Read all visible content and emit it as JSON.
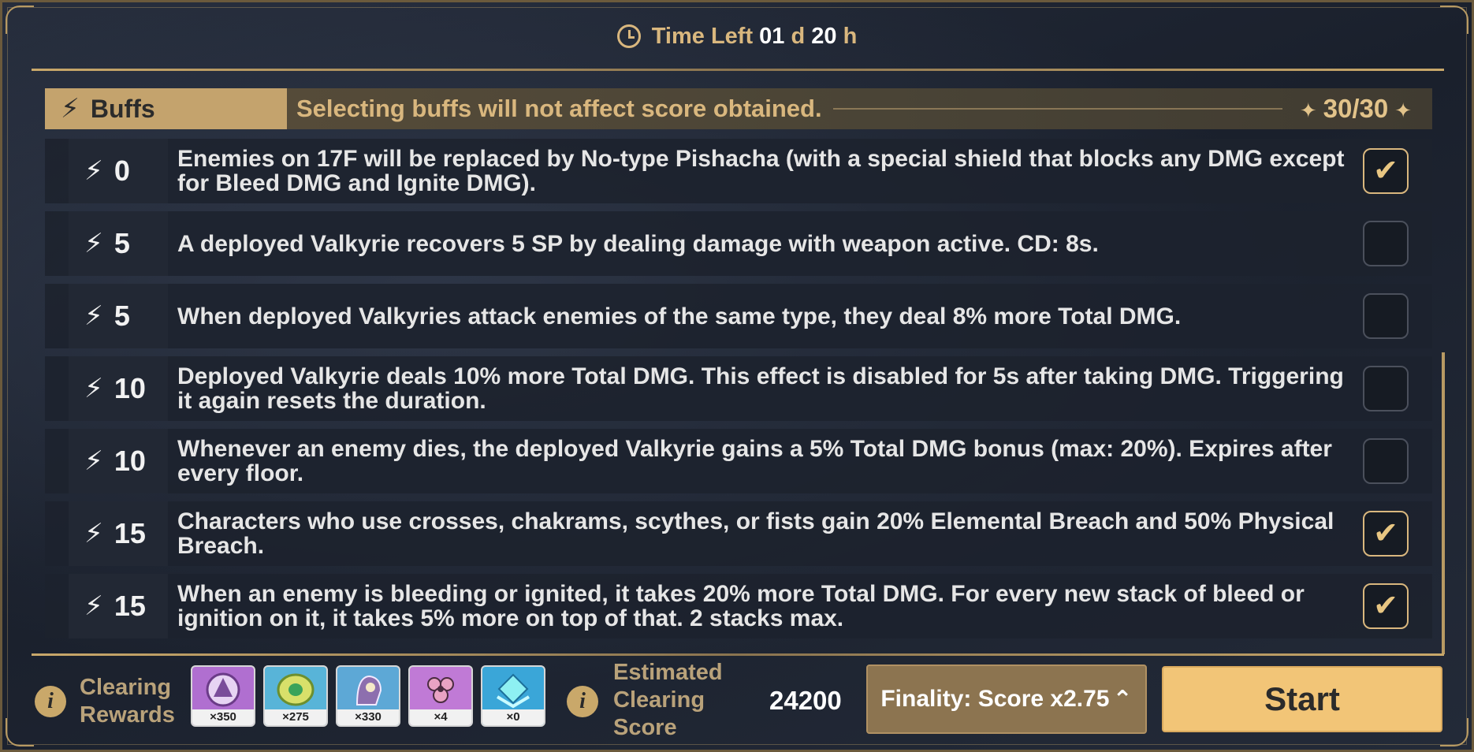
{
  "header": {
    "time_left_label": "Time Left",
    "days_value": "01",
    "days_unit": "d",
    "hours_value": "20",
    "hours_unit": "h"
  },
  "buffs": {
    "tab_label": "Buffs",
    "note": "Selecting buffs will not affect score obtained.",
    "count": "30/30",
    "items": [
      {
        "cost": "0",
        "description": "Enemies on 17F will be replaced by No-type Pishacha (with a special shield that blocks any DMG except for Bleed DMG and Ignite DMG).",
        "checked": true
      },
      {
        "cost": "5",
        "description": "A deployed Valkyrie recovers 5 SP by dealing damage with weapon active. CD: 8s.",
        "checked": false
      },
      {
        "cost": "5",
        "description": "When deployed Valkyries attack enemies of the same type, they deal 8% more Total DMG.",
        "checked": false
      },
      {
        "cost": "10",
        "description": "Deployed Valkyrie deals 10% more Total DMG. This effect is disabled for 5s after taking DMG. Triggering it again resets the duration.",
        "checked": false
      },
      {
        "cost": "10",
        "description": "Whenever an enemy dies, the deployed Valkyrie gains a 5% Total DMG bonus (max: 20%). Expires after every floor.",
        "checked": false
      },
      {
        "cost": "15",
        "description": "Characters who use crosses, chakrams, scythes, or fists gain 20% Elemental Breach and 50% Physical Breach.",
        "checked": true
      },
      {
        "cost": "15",
        "description": "When an enemy is bleeding or ignited, it takes 20% more Total DMG. For every new stack of bleed or ignition on it, it takes 5% more on top of that. 2 stacks max.",
        "checked": true
      }
    ]
  },
  "footer": {
    "clearing_rewards_line1": "Clearing",
    "clearing_rewards_line2": "Rewards",
    "rewards": [
      {
        "qty": "×350",
        "icon": "stigmata-shard-icon",
        "bg": "#b06fd0"
      },
      {
        "qty": "×275",
        "icon": "coin-icon",
        "bg": "#58b4d8"
      },
      {
        "qty": "×330",
        "icon": "warrior-badge-icon",
        "bg": "#5da8d6"
      },
      {
        "qty": "×4",
        "icon": "flower-crystal-icon",
        "bg": "#c07ad6"
      },
      {
        "qty": "×0",
        "icon": "diamond-icon",
        "bg": "#3aa6d8"
      }
    ],
    "estimated_line1": "Estimated",
    "estimated_line2": "Clearing",
    "estimated_line3": "Score",
    "score": "24200",
    "finality_label": "Finality: Score x2.75",
    "start_label": "Start"
  },
  "colors": {
    "accent_gold": "#d9b77e",
    "button_gold": "#f2c577",
    "panel_dark": "#1c2230"
  }
}
